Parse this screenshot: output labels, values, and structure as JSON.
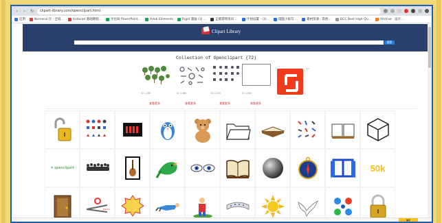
{
  "browser": {
    "url": "clipart-library.com/openclipart.html",
    "bookmarks": [
      "应用",
      "Numeral 计 · 全班...",
      "Autocad 基础教程...",
      "文化局 PowerPoint...",
      "Adob Elements",
      "Rigid 漫画 (3) ...",
      "正版游戏资讯 ...",
      "计划设置 · (3)...",
      "电脑小技巧 ...",
      "素材资源 · 其他...",
      "DCC Best High-Qu...",
      "Vertrue · 设计..."
    ],
    "colors": {
      "header": "#29406c",
      "frame": "#1f5eb6",
      "page_bg": "#f3d97a"
    }
  },
  "site": {
    "logo_text": "Clipart Library",
    "search_placeholder": "",
    "search_button": "搜索"
  },
  "collection": {
    "title": "Collection of Openclipart (72)",
    "previews": [
      {
        "caption": "ID: 1,298",
        "link": "查看更多"
      },
      {
        "caption": "ID: 1,085",
        "link": "查看更多"
      },
      {
        "caption": "ID: 1,200",
        "link": "查看更多"
      },
      {
        "caption": "ID: 1,000",
        "link": "查看更多"
      }
    ],
    "ad_label": "Ad"
  },
  "grid": {
    "items": [
      "padlock-open-icon",
      "symbols-sheet-icon",
      "openclipart-logo-icon",
      "penguin-icon",
      "teddy-bear-icon",
      "folder-icon",
      "open-book-icon",
      "tools-sheet-icon",
      "book-icon",
      "cube-icon",
      "openclipart-text-logo",
      "crowd-icon",
      "guitar-frame-icon",
      "parrot-icon",
      "eyes-icon",
      "bible-icon",
      "sphere-icon",
      "compass-icon",
      "window-icon",
      "50k-text",
      "door-icon",
      "scissors-icon",
      "50k-badge-icon",
      "flying-person-icon",
      "gardener-icon",
      "banner-icon",
      "sun-icon",
      "dove-icon",
      "splash-icon",
      "lock-icon"
    ],
    "text_50k": "50k",
    "openclipart_label": "openclipart"
  },
  "footer": {
    "button": "确定"
  }
}
